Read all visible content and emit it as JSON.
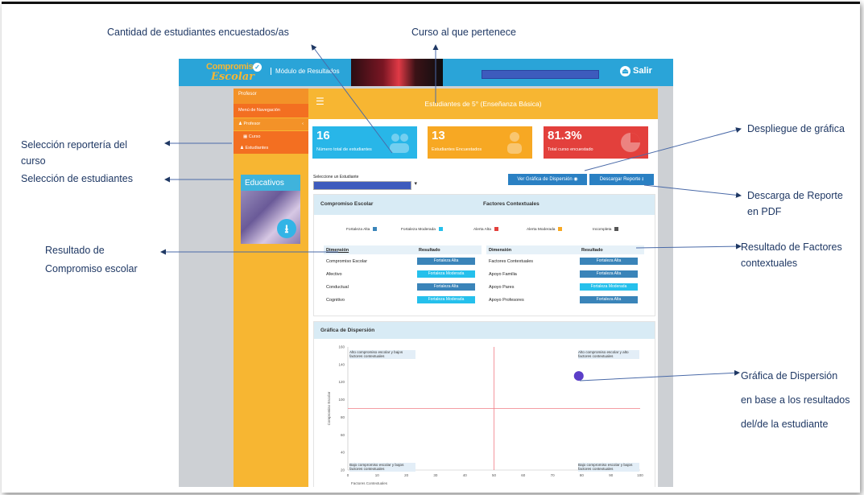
{
  "annotations": {
    "cantidad": "Cantidad de estudiantes encuestados/as",
    "curso": "Curso al que pertenece",
    "seleccion_reporteria": [
      "Selección reportería del",
      "curso"
    ],
    "seleccion_estudiantes": "Selección de estudiantes",
    "despliegue": "Despliegue de gráfica",
    "descarga": [
      "Descarga de Reporte",
      "en PDF"
    ],
    "resultado_compromiso": [
      "Resultado de",
      "Compromiso escolar"
    ],
    "resultado_factores": [
      "Resultado de Factores",
      "contextuales"
    ],
    "grafica": [
      "Gráfica de Dispersión",
      "en base a los resultados",
      "del/de la estudiante"
    ]
  },
  "app": {
    "logo_top": "Compromiso",
    "logo_bottom": "Escolar",
    "module_title": "Módulo de Resultados",
    "salir": "Salir"
  },
  "sidebar": {
    "role": "Profesor",
    "nav_title": "Menú de Navegación",
    "profesor": "Profesor",
    "curso": "Curso",
    "estudiantes": "Estudiantes",
    "resource_title": "Educativos"
  },
  "header": {
    "title": "Estudiantes de 5° (Enseñanza Básica)"
  },
  "cards": [
    {
      "number": "16",
      "label": "Número total de estudiantes",
      "color": "#28b6e8"
    },
    {
      "number": "13",
      "label": "Estudiantes Encuestados",
      "color": "#f7a823"
    },
    {
      "number": "81.3%",
      "label": "Total curso encuestado",
      "color": "#e3403c"
    }
  ],
  "student_select": {
    "label": "Seleccione un Estudiante"
  },
  "buttons": {
    "scatter": "Ver Gráfica de Dispersión",
    "download": "Descargar Reporte"
  },
  "results": {
    "compromiso_header": "Compromiso Escolar",
    "factores_header": "Factores Contextuales",
    "legend": [
      {
        "label": "Fortaleza Alta",
        "color": "#3a84b9"
      },
      {
        "label": "Fortaleza Moderada",
        "color": "#25c0ec"
      },
      {
        "label": "Alerta Alta",
        "color": "#e3403c"
      },
      {
        "label": "Alerta Moderada",
        "color": "#f7a823"
      },
      {
        "label": "Incompleta",
        "color": "#555555"
      }
    ],
    "col_dimension": "Dimensión",
    "col_resultado": "Resultado",
    "compromiso_rows": [
      {
        "dim": "Compromiso Escolar",
        "res": "Fortaleza Alta"
      },
      {
        "dim": "Afectivo",
        "res": "Fortaleza Moderada"
      },
      {
        "dim": "Conductual",
        "res": "Fortaleza Alta"
      },
      {
        "dim": "Cognitivo",
        "res": "Fortaleza Moderada"
      }
    ],
    "factores_rows": [
      {
        "dim": "Factores Contextuales",
        "res": "Fortaleza Alta"
      },
      {
        "dim": "Apoyo Familia",
        "res": "Fortaleza Alta"
      },
      {
        "dim": "Apoyo Pares",
        "res": "Fortaleza Moderada"
      },
      {
        "dim": "Apoyo Profesores",
        "res": "Fortaleza Alta"
      }
    ]
  },
  "scatter": {
    "title": "Gráfica de Dispersión",
    "q_top_left": "Alto compromiso escolar y bajos factores contextuales",
    "q_top_right": "Alto compromiso escolar y alto factores contextuales",
    "q_bottom_left": "Bajo compromiso escolar y bajos factores contextuales",
    "q_bottom_right": "Bajo compromiso escolar y bajos factores contextuales",
    "ylabel": "Compromiso Escolar",
    "xlabel": "Factores Contextuales"
  },
  "chart_data": {
    "type": "scatter",
    "title": "Gráfica de Dispersión",
    "xlabel": "Factores Contextuales",
    "ylabel": "Compromiso Escolar",
    "xlim": [
      0,
      100
    ],
    "ylim": [
      20,
      160
    ],
    "xticks": [
      0,
      10,
      20,
      30,
      40,
      50,
      60,
      70,
      80,
      90,
      100
    ],
    "yticks": [
      20,
      40,
      60,
      80,
      100,
      120,
      140,
      160
    ],
    "reference_lines": {
      "x": 50,
      "y": 90
    },
    "series": [
      {
        "x": [
          79
        ],
        "y": [
          127
        ],
        "color": "#5b3ec8"
      }
    ],
    "grid": false
  }
}
